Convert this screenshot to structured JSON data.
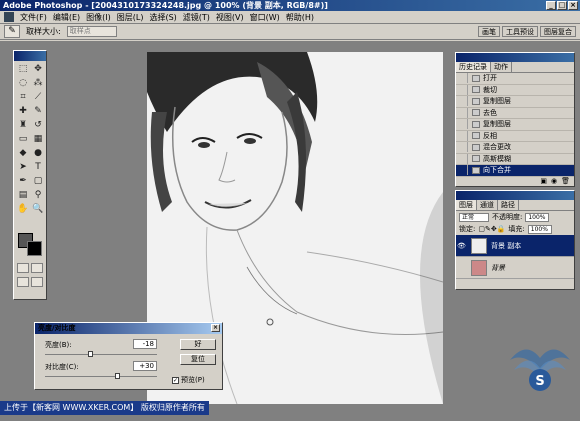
{
  "window": {
    "app_title": "Adobe Photoshop - [2004310173324248.jpg @ 100% (背景 副本, RGB/8#)]"
  },
  "menu": {
    "items": [
      "文件(F)",
      "编辑(E)",
      "图像(I)",
      "图层(L)",
      "选择(S)",
      "滤镜(T)",
      "视图(V)",
      "窗口(W)",
      "帮助(H)"
    ]
  },
  "options": {
    "sample_size_label": "取样大小:",
    "sample_size_value": "取样点",
    "tabs": [
      "画笔",
      "工具预设",
      "图层复合"
    ]
  },
  "history": {
    "tabs": [
      "历史记录",
      "动作"
    ],
    "items": [
      "打开",
      "裁切",
      "复制图层",
      "去色",
      "复制图层",
      "反相",
      "混合更改",
      "高斯模糊",
      "向下合并"
    ],
    "selected_index": 8
  },
  "layers": {
    "tabs": [
      "图层",
      "通道",
      "路径"
    ],
    "blend_mode": "正常",
    "opacity_label": "不透明度:",
    "opacity_value": "100%",
    "lock_label": "锁定:",
    "fill_label": "填充:",
    "fill_value": "100%",
    "items": [
      {
        "name": "背景 副本",
        "selected": true
      },
      {
        "name": "背景",
        "selected": false
      }
    ]
  },
  "dialog": {
    "title": "亮度/对比度",
    "brightness_label": "亮度(B):",
    "brightness_value": "-18",
    "brightness": -18,
    "contrast_label": "对比度(C):",
    "contrast_value": "+30",
    "contrast": 30,
    "ok_label": "好",
    "reset_label": "复位",
    "preview_label": "预览(P)",
    "preview_checked": true,
    "slider_range": [
      -100,
      100
    ]
  },
  "watermark": {
    "text": "上传于【新客网 WWW.XKER.COM】 版权归原作者所有"
  },
  "colors": {
    "title_bar": "#0a246a",
    "ui_face": "#d4d0c8",
    "workspace": "#808080",
    "selection": "#0a246a"
  }
}
